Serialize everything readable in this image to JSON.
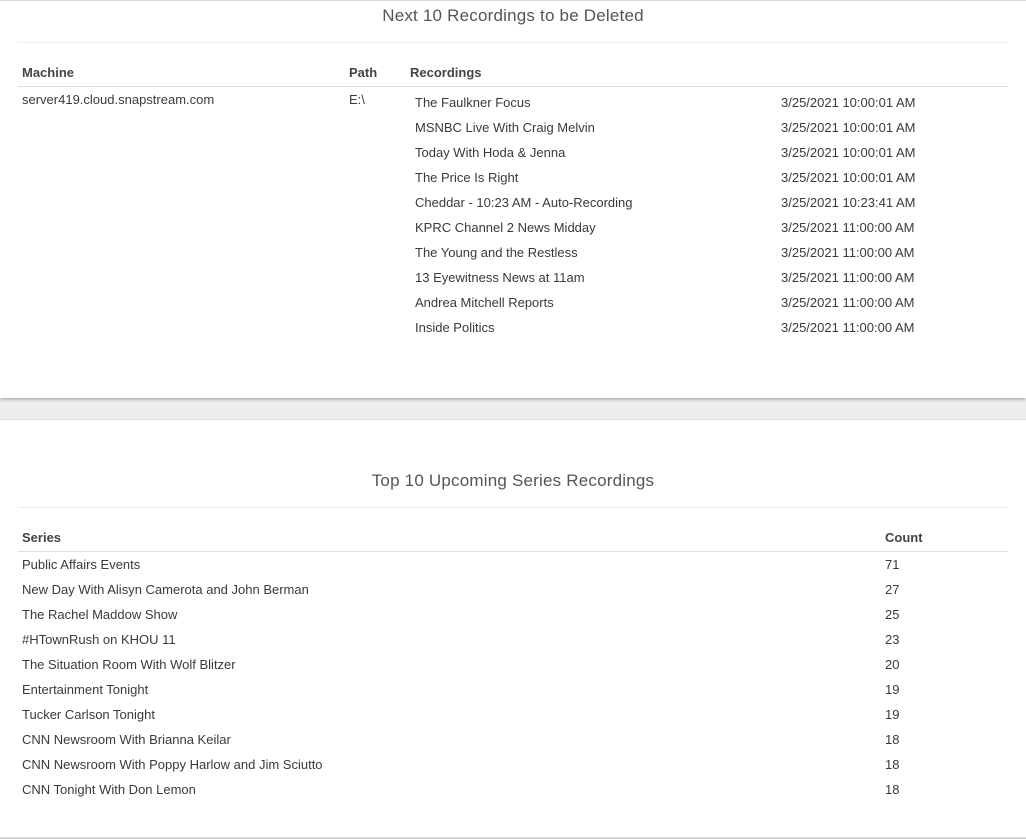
{
  "deleted_panel": {
    "title": "Next 10 Recordings to be Deleted",
    "headers": {
      "machine": "Machine",
      "path": "Path",
      "recordings": "Recordings"
    },
    "machine": "server419.cloud.snapstream.com",
    "path": "E:\\",
    "recordings": [
      {
        "name": "The Faulkner Focus",
        "time": "3/25/2021 10:00:01 AM"
      },
      {
        "name": "MSNBC Live With Craig Melvin",
        "time": "3/25/2021 10:00:01 AM"
      },
      {
        "name": "Today With Hoda & Jenna",
        "time": "3/25/2021 10:00:01 AM"
      },
      {
        "name": "The Price Is Right",
        "time": "3/25/2021 10:00:01 AM"
      },
      {
        "name": "Cheddar - 10:23 AM - Auto-Recording",
        "time": "3/25/2021 10:23:41 AM"
      },
      {
        "name": "KPRC Channel 2 News Midday",
        "time": "3/25/2021 11:00:00 AM"
      },
      {
        "name": "The Young and the Restless",
        "time": "3/25/2021 11:00:00 AM"
      },
      {
        "name": "13 Eyewitness News at 11am",
        "time": "3/25/2021 11:00:00 AM"
      },
      {
        "name": "Andrea Mitchell Reports",
        "time": "3/25/2021 11:00:00 AM"
      },
      {
        "name": "Inside Politics",
        "time": "3/25/2021 11:00:00 AM"
      }
    ]
  },
  "series_panel": {
    "title": "Top 10 Upcoming Series Recordings",
    "headers": {
      "series": "Series",
      "count": "Count"
    },
    "rows": [
      {
        "series": "Public Affairs Events",
        "count": "71"
      },
      {
        "series": "New Day With Alisyn Camerota and John Berman",
        "count": "27"
      },
      {
        "series": "The Rachel Maddow Show",
        "count": "25"
      },
      {
        "series": "#HTownRush on KHOU 11",
        "count": "23"
      },
      {
        "series": "The Situation Room With Wolf Blitzer",
        "count": "20"
      },
      {
        "series": "Entertainment Tonight",
        "count": "19"
      },
      {
        "series": "Tucker Carlson Tonight",
        "count": "19"
      },
      {
        "series": "CNN Newsroom With Brianna Keilar",
        "count": "18"
      },
      {
        "series": "CNN Newsroom With Poppy Harlow and Jim Sciutto",
        "count": "18"
      },
      {
        "series": "CNN Tonight With Don Lemon",
        "count": "18"
      }
    ]
  }
}
